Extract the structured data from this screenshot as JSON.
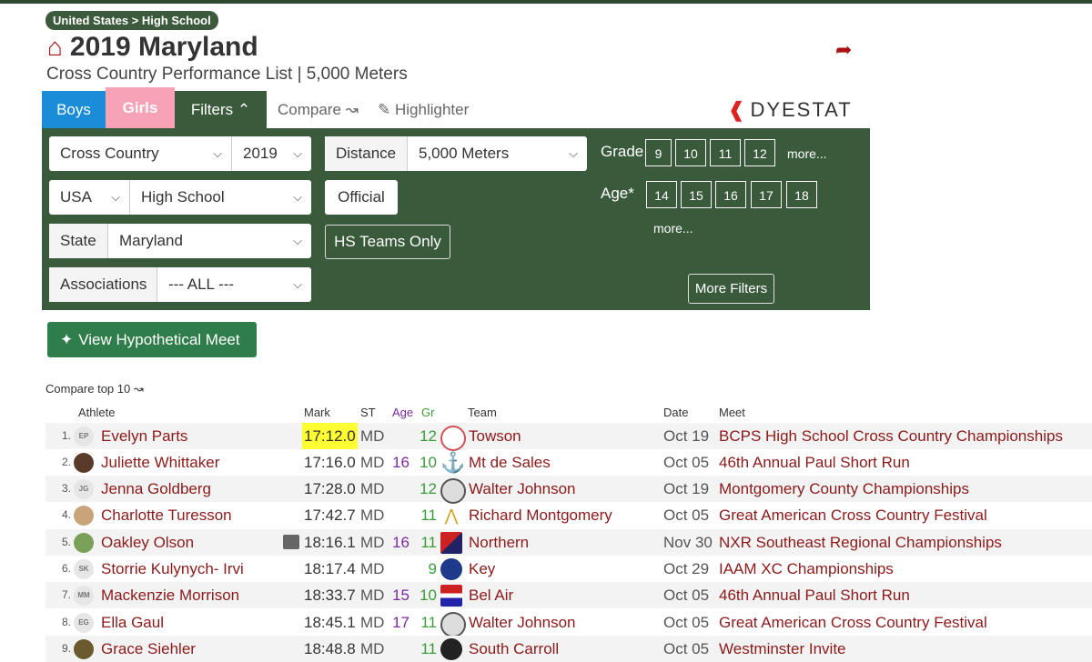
{
  "breadcrumb": "United States > High School",
  "title": "2019 Maryland",
  "subtitle": "Cross Country Performance List | 5,000 Meters",
  "tabs": {
    "boys": "Boys",
    "girls": "Girls",
    "filters": "Filters",
    "compare": "Compare",
    "highlighter": "Highlighter"
  },
  "logo_text": "DYESTAT",
  "filters": {
    "sport": "Cross Country",
    "year": "2019",
    "distance_label": "Distance",
    "distance": "5,000 Meters",
    "country": "USA",
    "level": "High School",
    "official": "Official",
    "state_label": "State",
    "state": "Maryland",
    "hs_teams": "HS Teams Only",
    "assoc_label": "Associations",
    "assoc": "--- ALL ---",
    "grade_label": "Grade",
    "grades": [
      "9",
      "10",
      "11",
      "12"
    ],
    "grade_more": "more...",
    "age_label": "Age*",
    "ages": [
      "14",
      "15",
      "16",
      "17",
      "18"
    ],
    "age_more": "more...",
    "more_filters": "More Filters"
  },
  "hypothetical": "View Hypothetical Meet",
  "compare_top": "Compare top 10",
  "columns": {
    "athlete": "Athlete",
    "mark": "Mark",
    "st": "ST",
    "age": "Age",
    "gr": "Gr",
    "team": "Team",
    "date": "Date",
    "meet": "Meet"
  },
  "rows": [
    {
      "rank": "1.",
      "initials": "EP",
      "name": "Evelyn Parts",
      "mark": "17:12.0",
      "st": "MD",
      "age": "",
      "gr": "12",
      "team": "Towson",
      "date": "Oct 19",
      "meet": "BCPS High School Cross Country Championships"
    },
    {
      "rank": "2.",
      "initials": "",
      "name": "Juliette Whittaker",
      "mark": "17:16.0",
      "st": "MD",
      "age": "16",
      "gr": "10",
      "team": "Mt de Sales",
      "date": "Oct 05",
      "meet": "46th Annual Paul Short Run"
    },
    {
      "rank": "3.",
      "initials": "JG",
      "name": "Jenna Goldberg",
      "mark": "17:28.0",
      "st": "MD",
      "age": "",
      "gr": "12",
      "team": "Walter Johnson",
      "date": "Oct 19",
      "meet": "Montgomery County Championships"
    },
    {
      "rank": "4.",
      "initials": "",
      "name": "Charlotte Turesson",
      "mark": "17:42.7",
      "st": "MD",
      "age": "",
      "gr": "11",
      "team": "Richard Montgomery",
      "date": "Oct 05",
      "meet": "Great American Cross Country Festival"
    },
    {
      "rank": "5.",
      "initials": "",
      "name": "Oakley Olson",
      "mark": "18:16.1",
      "st": "MD",
      "age": "16",
      "gr": "11",
      "team": "Northern",
      "date": "Nov 30",
      "meet": "NXR Southeast Regional Championships"
    },
    {
      "rank": "6.",
      "initials": "SK",
      "name": "Storrie Kulynych- Irvi",
      "mark": "18:17.4",
      "st": "MD",
      "age": "",
      "gr": "9",
      "team": "Key",
      "date": "Oct 29",
      "meet": "IAAM XC Championships"
    },
    {
      "rank": "7.",
      "initials": "MM",
      "name": "Mackenzie Morrison",
      "mark": "18:33.7",
      "st": "MD",
      "age": "15",
      "gr": "10",
      "team": "Bel Air",
      "date": "Oct 05",
      "meet": "46th Annual Paul Short Run"
    },
    {
      "rank": "8.",
      "initials": "EG",
      "name": "Ella Gaul",
      "mark": "18:45.1",
      "st": "MD",
      "age": "17",
      "gr": "11",
      "team": "Walter Johnson",
      "date": "Oct 05",
      "meet": "Great American Cross Country Festival"
    },
    {
      "rank": "9.",
      "initials": "",
      "name": "Grace Siehler",
      "mark": "18:48.8",
      "st": "MD",
      "age": "",
      "gr": "11",
      "team": "South Carroll",
      "date": "Oct 05",
      "meet": "Westminster Invite"
    }
  ],
  "colors": {
    "brand_green": "#3a5a3c",
    "name_red": "#8b1a1a",
    "highlight": "#ffff33"
  }
}
